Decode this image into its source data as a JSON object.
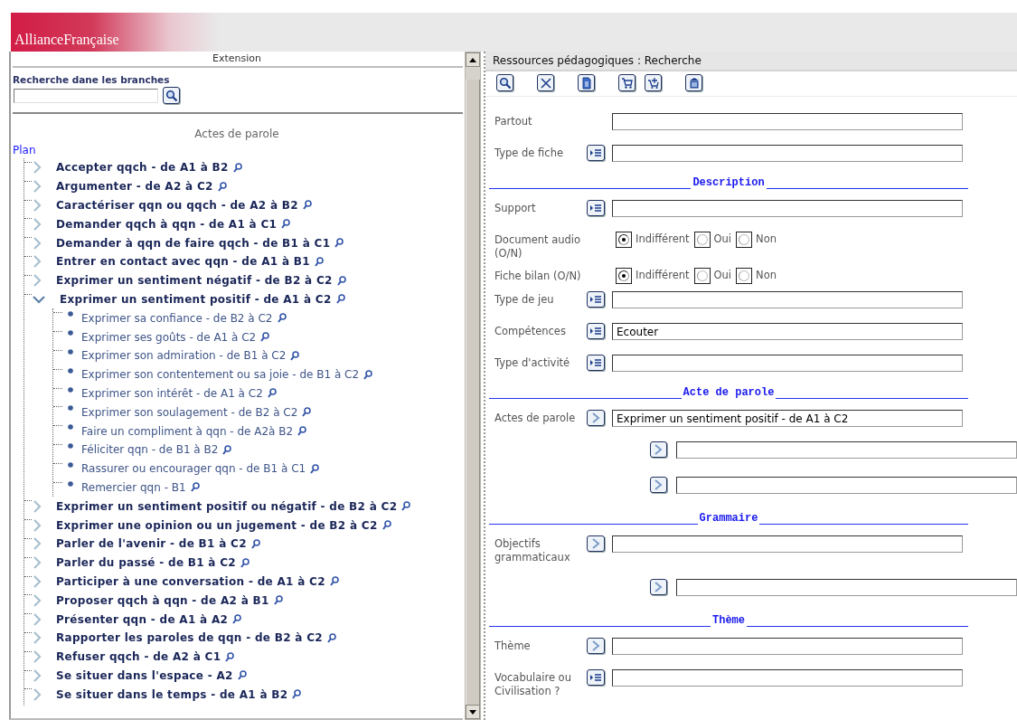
{
  "header": {
    "logo": "AllianceFrançaise"
  },
  "left": {
    "title": "Extension",
    "search_label": "Recherche dane les branches",
    "tree_title": "Actes de parole",
    "plan": "Plan",
    "items": [
      {
        "label": "Accepter qqch - de A1 à B2",
        "expanded": false
      },
      {
        "label": "Argumenter - de A2 à C2",
        "expanded": false
      },
      {
        "label": "Caractériser qqn ou qqch - de A2 à B2",
        "expanded": false
      },
      {
        "label": "Demander qqch à qqn - de A1 à C1",
        "expanded": false
      },
      {
        "label": "Demander à qqn de faire qqch - de B1 à C1",
        "expanded": false
      },
      {
        "label": "Entrer en contact avec qqn - de A1 à B1",
        "expanded": false
      },
      {
        "label": "Exprimer un sentiment négatif - de B2 à C2",
        "expanded": false
      },
      {
        "label": "Exprimer un sentiment positif - de A1 à C2",
        "expanded": true,
        "children": [
          {
            "label": "Exprimer sa confiance - de B2 à C2"
          },
          {
            "label": "Exprimer ses goûts - de A1 à C2"
          },
          {
            "label": "Exprimer son admiration - de B1 à C2"
          },
          {
            "label": "Exprimer son contentement ou sa joie - de B1 à C2"
          },
          {
            "label": "Exprimer son intérêt - de A1 à C2"
          },
          {
            "label": "Exprimer son soulagement - de B2 à C2"
          },
          {
            "label": "Faire un compliment à qqn - de A2à B2"
          },
          {
            "label": "Féliciter qqn - de B1 à B2"
          },
          {
            "label": "Rassurer ou encourager qqn - de B1 à C1"
          },
          {
            "label": "Remercier qqn - B1"
          }
        ]
      },
      {
        "label": "Exprimer un sentiment positif ou négatif - de B2 à C2",
        "expanded": false
      },
      {
        "label": "Exprimer une opinion ou un jugement - de B2 à C2",
        "expanded": false
      },
      {
        "label": "Parler de l'avenir - de B1 à C2",
        "expanded": false
      },
      {
        "label": "Parler du passé - de B1 à C2",
        "expanded": false
      },
      {
        "label": "Participer à une conversation - de A1 à C2",
        "expanded": false
      },
      {
        "label": "Proposer qqch à qqn - de A2 à B1",
        "expanded": false
      },
      {
        "label": "Présenter qqn - de A1 à A2",
        "expanded": false
      },
      {
        "label": "Rapporter les paroles de qqn - de B2 à C2",
        "expanded": false
      },
      {
        "label": "Refuser qqch - de A2 à C1",
        "expanded": false
      },
      {
        "label": "Se situer dans l'espace - A2",
        "expanded": false
      },
      {
        "label": "Se situer dans le temps - de A1 à B2",
        "expanded": false
      }
    ]
  },
  "right": {
    "title": "Ressources pédagogiques : Recherche",
    "toolbar": [
      [
        {
          "kind": "search"
        },
        {
          "kind": "clear"
        },
        {
          "kind": "document"
        }
      ],
      [
        {
          "kind": "cart"
        },
        {
          "kind": "cart-add"
        }
      ],
      [
        {
          "kind": "archive"
        }
      ]
    ],
    "rows": [
      {
        "kind": "field",
        "label": "Partout"
      },
      {
        "kind": "field",
        "label": "Type de fiche",
        "button": {
          "kind": "list"
        }
      },
      {
        "kind": "section",
        "title": "Description"
      },
      {
        "kind": "field",
        "label": "Support",
        "button": {
          "kind": "list"
        }
      },
      {
        "kind": "radio",
        "label": "Document audio (O/N)",
        "options": [
          {
            "label": "Indifférent",
            "selected": true
          },
          {
            "label": "Oui",
            "selected": false
          },
          {
            "label": "Non",
            "selected": false
          }
        ]
      },
      {
        "kind": "radio",
        "label": "Fiche bilan (O/N)",
        "options": [
          {
            "label": "Indifférent",
            "selected": true
          },
          {
            "label": "Oui",
            "selected": false
          },
          {
            "label": "Non",
            "selected": false
          }
        ]
      },
      {
        "kind": "field",
        "label": "Type de jeu",
        "button": {
          "kind": "list"
        }
      },
      {
        "kind": "field",
        "label": "Compétences",
        "button": {
          "kind": "list"
        },
        "value": "Ecouter"
      },
      {
        "kind": "field",
        "label": "Type d'activité",
        "button": {
          "kind": "list"
        }
      },
      {
        "kind": "section",
        "title": "Acte de parole"
      },
      {
        "kind": "field",
        "label": "Actes de parole",
        "button": {
          "kind": "arrow"
        },
        "value": "Exprimer un sentiment positif - de A1 à C2"
      },
      {
        "kind": "extra",
        "button": {
          "kind": "arrow"
        }
      },
      {
        "kind": "extra",
        "button": {
          "kind": "arrow"
        }
      },
      {
        "kind": "section",
        "title": "Grammaire"
      },
      {
        "kind": "field",
        "label": "Objectifs grammaticaux",
        "button": {
          "kind": "arrow"
        }
      },
      {
        "kind": "extra",
        "button": {
          "kind": "arrow"
        }
      },
      {
        "kind": "section",
        "title": "Thème"
      },
      {
        "kind": "field",
        "label": "Thème",
        "button": {
          "kind": "arrow"
        }
      },
      {
        "kind": "field",
        "label": "Vocabulaire ou Civilisation ?",
        "button": {
          "kind": "list"
        }
      }
    ]
  }
}
